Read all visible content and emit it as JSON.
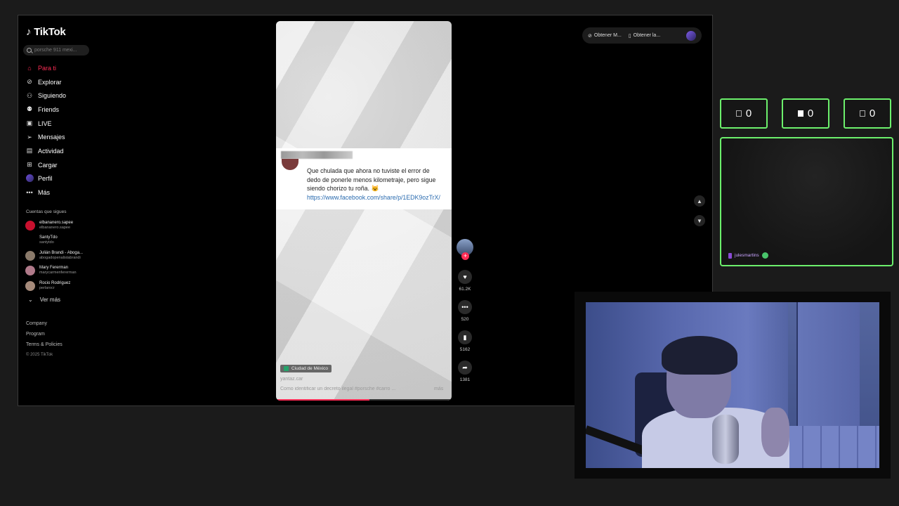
{
  "tiktok": {
    "logo_text": "TikTok",
    "search_placeholder": "porsche 911 mexi...",
    "nav": [
      {
        "label": "Para ti",
        "icon": "home-icon",
        "glyph": "⌂"
      },
      {
        "label": "Explorar",
        "icon": "compass-icon",
        "glyph": "⊘"
      },
      {
        "label": "Siguiendo",
        "icon": "user-plus-icon",
        "glyph": "⚇"
      },
      {
        "label": "Friends",
        "icon": "friends-icon",
        "glyph": "⚉"
      },
      {
        "label": "LIVE",
        "icon": "live-icon",
        "glyph": "▣"
      },
      {
        "label": "Mensajes",
        "icon": "send-icon",
        "glyph": "➢"
      },
      {
        "label": "Actividad",
        "icon": "inbox-icon",
        "glyph": "▤"
      },
      {
        "label": "Cargar",
        "icon": "upload-icon",
        "glyph": "⊞"
      },
      {
        "label": "Perfil",
        "icon": "profile-avatar",
        "glyph": ""
      },
      {
        "label": "Más",
        "icon": "more-icon",
        "glyph": "•••"
      }
    ],
    "following_title": "Cuentas que sigues",
    "accounts": [
      {
        "name": "elbananero.sapee",
        "handle": "elbananero.sapee",
        "color": "#c8102e"
      },
      {
        "name": "SantyTdo",
        "handle": "santytdo",
        "color": "#000000"
      },
      {
        "name": "Julián Brandi - Aboga...",
        "handle": "abogadopenalistabrandi",
        "color": "#8a7a6a"
      },
      {
        "name": "Mary Fererman",
        "handle": "marycarmenfererman",
        "color": "#b07a8a"
      },
      {
        "name": "Rocio Rodriguez",
        "handle": "perlarocr",
        "color": "#a58a7a"
      }
    ],
    "see_more": "Ver más",
    "footer": {
      "company": "Company",
      "program": "Program",
      "terms": "Terms & Policies",
      "copyright": "© 2025 TikTok"
    },
    "top_actions": {
      "get_coins": "Obtener M...",
      "get_app": "Obtener la..."
    },
    "video": {
      "comment_text": "Que chulada que ahora no tuviste el error de dedo de ponerle menos kilometraje, pero sigue siendo chorizo tu roña. 😺",
      "comment_link": "https://www.facebook.com/share/p/1EDK9ozTrX/",
      "location": "Ciudad de México",
      "author": "yantaz.car",
      "caption": "Como identificar un decreto ilegal #porsche #carro ...",
      "more": "más",
      "progress": 0.53
    },
    "actions": {
      "likes": "61.2K",
      "comments": "520",
      "saves": "5162",
      "shares": "1381"
    }
  },
  "overlay": {
    "counters": [
      "0",
      "0",
      "0"
    ],
    "chat_user": "julesmartins",
    "accent": "#6cf06c"
  }
}
